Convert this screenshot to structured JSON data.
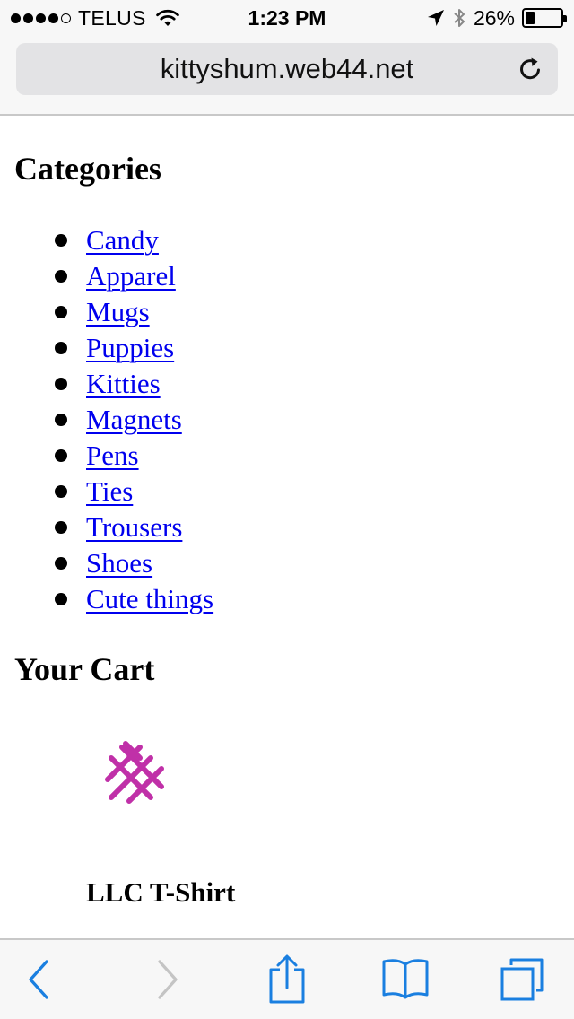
{
  "status_bar": {
    "carrier": "TELUS",
    "time": "1:23 PM",
    "battery_percent": "26%",
    "battery_level": 0.26,
    "signal_bars_filled": 4,
    "signal_bars_total": 5
  },
  "browser": {
    "url": "kittyshum.web44.net",
    "accent_color": "#1a7fe0"
  },
  "page": {
    "categories_heading": "Categories",
    "categories": [
      {
        "label": "Candy"
      },
      {
        "label": "Apparel"
      },
      {
        "label": "Mugs"
      },
      {
        "label": "Puppies"
      },
      {
        "label": "Kitties"
      },
      {
        "label": "Magnets"
      },
      {
        "label": "Pens"
      },
      {
        "label": "Ties"
      },
      {
        "label": "Trousers"
      },
      {
        "label": "Shoes"
      },
      {
        "label": "Cute things"
      }
    ],
    "cart_heading": "Your Cart",
    "cart_items": [
      {
        "name": "LLC T-Shirt",
        "image_icon": "magenta-hashtag-pattern"
      }
    ],
    "link_color": "#0000ee"
  },
  "toolbar": {
    "icons": [
      "back-icon",
      "forward-icon",
      "share-icon",
      "bookmarks-icon",
      "tabs-icon"
    ]
  }
}
